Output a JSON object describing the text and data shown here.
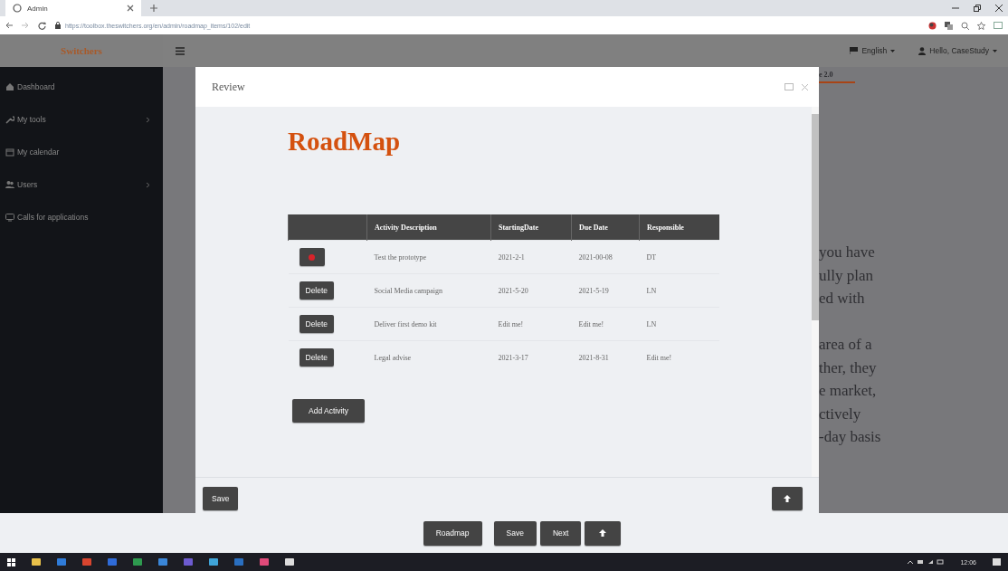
{
  "browser": {
    "tab_title": "Admin",
    "url": "https://toolbox.theswitchers.org/en/admin/roadmap_items/102/edit"
  },
  "app": {
    "logo": "Switchers",
    "language": "English",
    "user": "Hello, CaseStudy"
  },
  "sidebar": {
    "items": [
      {
        "label": "Dashboard",
        "expandable": false
      },
      {
        "label": "My tools",
        "expandable": true
      },
      {
        "label": "My calendar",
        "expandable": false
      },
      {
        "label": "Users",
        "expandable": true
      },
      {
        "label": "Calls for applications",
        "expandable": false
      }
    ]
  },
  "background_page": {
    "heading": "e 2.0",
    "paragraphs": [
      [
        "you have",
        "ully plan",
        "ed with"
      ],
      [
        "area of a",
        "ther, they",
        "e market,",
        "ctively",
        "-day basis"
      ]
    ]
  },
  "modal": {
    "title": "Review",
    "heading": "RoadMap",
    "table": {
      "columns": [
        "Activity Description",
        "StartingDate",
        "Due Date",
        "Responsible"
      ],
      "rows": [
        {
          "action": {
            "kind": "icon"
          },
          "cells": [
            "Test the prototype",
            "2021-2-1",
            "2021-00-08",
            "DT"
          ]
        },
        {
          "action": {
            "kind": "text",
            "label": "Delete"
          },
          "cells": [
            "Social Media campaign",
            "2021-5-20",
            "2021-5-19",
            "LN"
          ]
        },
        {
          "action": {
            "kind": "text",
            "label": "Delete"
          },
          "cells": [
            "Deliver first demo kit",
            "Edit me!",
            "Edit me!",
            "LN"
          ]
        },
        {
          "action": {
            "kind": "text",
            "label": "Delete"
          },
          "cells": [
            "Legal advise",
            "2021-3-17",
            "2021-8-31",
            "Edit me!"
          ]
        }
      ]
    },
    "add_button": "Add Activity",
    "footer_save": "Save"
  },
  "bottom_bar": {
    "buttons": [
      "Roadmap",
      "Save",
      "Next"
    ]
  },
  "taskbar": {
    "clock": "12:06"
  }
}
